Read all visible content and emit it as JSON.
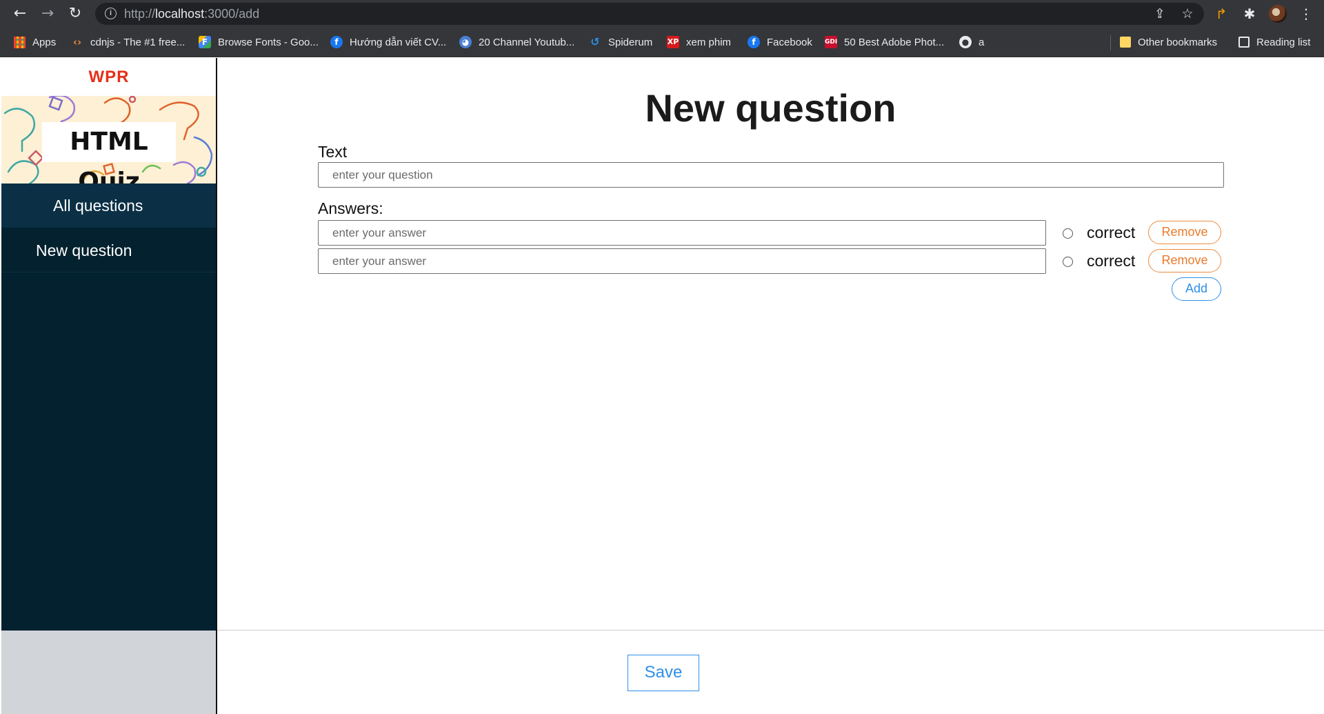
{
  "browser": {
    "url_scheme": "http://",
    "url_host": "localhost",
    "url_path": ":3000/add",
    "bookmarks": [
      {
        "label": "Apps",
        "icon": "apps-grid-icon"
      },
      {
        "label": "cdnjs - The #1 free...",
        "icon": "code-icon"
      },
      {
        "label": "Browse Fonts - Goo...",
        "icon": "google-fonts-icon"
      },
      {
        "label": "Hướng dẫn viết CV...",
        "icon": "facebook-icon"
      },
      {
        "label": "20 Channel Youtub...",
        "icon": "ghost-icon"
      },
      {
        "label": "Spiderum",
        "icon": "spiderum-icon"
      },
      {
        "label": "xem phim",
        "icon": "xp-icon"
      },
      {
        "label": "Facebook",
        "icon": "facebook-icon"
      },
      {
        "label": "50 Best Adobe Phot...",
        "icon": "gdi-icon"
      },
      {
        "label": "a",
        "icon": "globe-icon"
      }
    ],
    "other_bookmarks": "Other bookmarks",
    "reading_list": "Reading list"
  },
  "sidebar": {
    "brand": "WPR",
    "hero_title": "HTML Quiz",
    "items": [
      {
        "label": "All questions",
        "active": true
      },
      {
        "label": "New question",
        "active": false
      }
    ]
  },
  "main": {
    "title": "New question",
    "text_label": "Text",
    "text_placeholder": "enter your question",
    "answers_label": "Answers:",
    "answers": [
      {
        "placeholder": "enter your answer",
        "correct_label": "correct",
        "remove_label": "Remove"
      },
      {
        "placeholder": "enter your answer",
        "correct_label": "correct",
        "remove_label": "Remove"
      }
    ],
    "add_label": "Add"
  },
  "footer": {
    "save_label": "Save"
  },
  "colors": {
    "brand": "#e53018",
    "sidebar_bg": "#03212f",
    "sidebar_active": "#0b3046",
    "remove": "#ea7a2a",
    "primary": "#2d8fe8"
  }
}
